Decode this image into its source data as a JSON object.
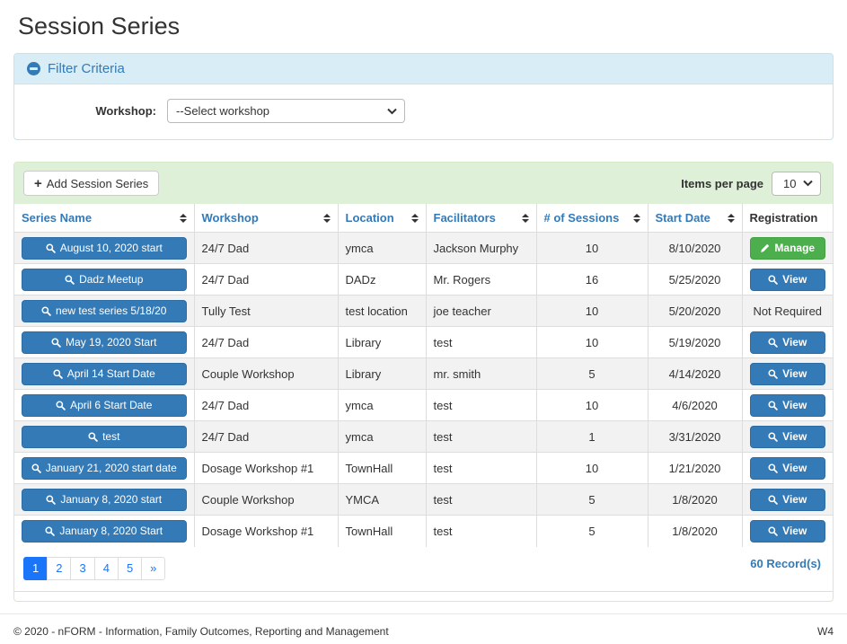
{
  "page": {
    "title": "Session Series",
    "footer_left": "© 2020 - nFORM - Information, Family Outcomes, Reporting and Management",
    "footer_right": "W4"
  },
  "filter": {
    "header": "Filter Criteria",
    "collapse_icon": "minus-circle-icon",
    "workshop_label": "Workshop:",
    "workshop_value": "--Select workshop"
  },
  "toolbar": {
    "add_button": "Add Session Series",
    "add_icon": "plus-icon",
    "items_per_page_label": "Items per page",
    "items_per_page_value": "10"
  },
  "table": {
    "columns": [
      {
        "label": "Series Name",
        "sortable": true
      },
      {
        "label": "Workshop",
        "sortable": true
      },
      {
        "label": "Location",
        "sortable": true
      },
      {
        "label": "Facilitators",
        "sortable": true
      },
      {
        "label": "# of Sessions",
        "sortable": true
      },
      {
        "label": "Start Date",
        "sortable": true
      },
      {
        "label": "Registration",
        "sortable": false
      }
    ],
    "rows": [
      {
        "series_name": "August 10, 2020 start",
        "workshop": "24/7 Dad",
        "location": "ymca",
        "facilitators": "Jackson Murphy",
        "sessions": "10",
        "start_date": "8/10/2020",
        "registration": {
          "type": "manage",
          "label": "Manage",
          "icon": "pencil-icon"
        }
      },
      {
        "series_name": "Dadz Meetup",
        "workshop": "24/7 Dad",
        "location": "DADz",
        "facilitators": "Mr. Rogers",
        "sessions": "16",
        "start_date": "5/25/2020",
        "registration": {
          "type": "view",
          "label": "View",
          "icon": "search-icon"
        }
      },
      {
        "series_name": "new test series 5/18/20",
        "workshop": "Tully Test",
        "location": "test location",
        "facilitators": "joe teacher",
        "sessions": "10",
        "start_date": "5/20/2020",
        "registration": {
          "type": "text",
          "label": "Not Required"
        }
      },
      {
        "series_name": "May 19, 2020 Start",
        "workshop": "24/7 Dad",
        "location": "Library",
        "facilitators": "test",
        "sessions": "10",
        "start_date": "5/19/2020",
        "registration": {
          "type": "view",
          "label": "View",
          "icon": "search-icon"
        }
      },
      {
        "series_name": "April 14 Start Date",
        "workshop": "Couple Workshop",
        "location": "Library",
        "facilitators": "mr. smith",
        "sessions": "5",
        "start_date": "4/14/2020",
        "registration": {
          "type": "view",
          "label": "View",
          "icon": "search-icon"
        }
      },
      {
        "series_name": "April 6 Start Date",
        "workshop": "24/7 Dad",
        "location": "ymca",
        "facilitators": "test",
        "sessions": "10",
        "start_date": "4/6/2020",
        "registration": {
          "type": "view",
          "label": "View",
          "icon": "search-icon"
        }
      },
      {
        "series_name": "test",
        "workshop": "24/7 Dad",
        "location": "ymca",
        "facilitators": "test",
        "sessions": "1",
        "start_date": "3/31/2020",
        "registration": {
          "type": "view",
          "label": "View",
          "icon": "search-icon"
        }
      },
      {
        "series_name": "January 21, 2020 start date",
        "workshop": "Dosage Workshop #1",
        "location": "TownHall",
        "facilitators": "test",
        "sessions": "10",
        "start_date": "1/21/2020",
        "registration": {
          "type": "view",
          "label": "View",
          "icon": "search-icon"
        }
      },
      {
        "series_name": "January 8, 2020 start",
        "workshop": "Couple Workshop",
        "location": "YMCA",
        "facilitators": "test",
        "sessions": "5",
        "start_date": "1/8/2020",
        "registration": {
          "type": "view",
          "label": "View",
          "icon": "search-icon"
        }
      },
      {
        "series_name": "January 8, 2020 Start",
        "workshop": "Dosage Workshop #1",
        "location": "TownHall",
        "facilitators": "test",
        "sessions": "5",
        "start_date": "1/8/2020",
        "registration": {
          "type": "view",
          "label": "View",
          "icon": "search-icon"
        }
      }
    ],
    "series_button_icon": "search-icon",
    "sort_icon": "sort-icon"
  },
  "pagination": {
    "pages": [
      {
        "label": "1",
        "active": true
      },
      {
        "label": "2",
        "active": false
      },
      {
        "label": "3",
        "active": false
      },
      {
        "label": "4",
        "active": false
      },
      {
        "label": "5",
        "active": false
      },
      {
        "label": "»",
        "active": false
      }
    ],
    "records": "60 Record(s)"
  },
  "colors": {
    "primary_blue": "#337ab7",
    "success_green": "#4cae4c",
    "pagination_blue": "#1b75f8",
    "panel_green_bg": "#dff0d8",
    "panel_green_border": "#d6e9c6",
    "filter_blue_bg": "#d9edf7",
    "filter_blue_border": "#bce8f1",
    "row_stripe": "#f2f2f2"
  }
}
